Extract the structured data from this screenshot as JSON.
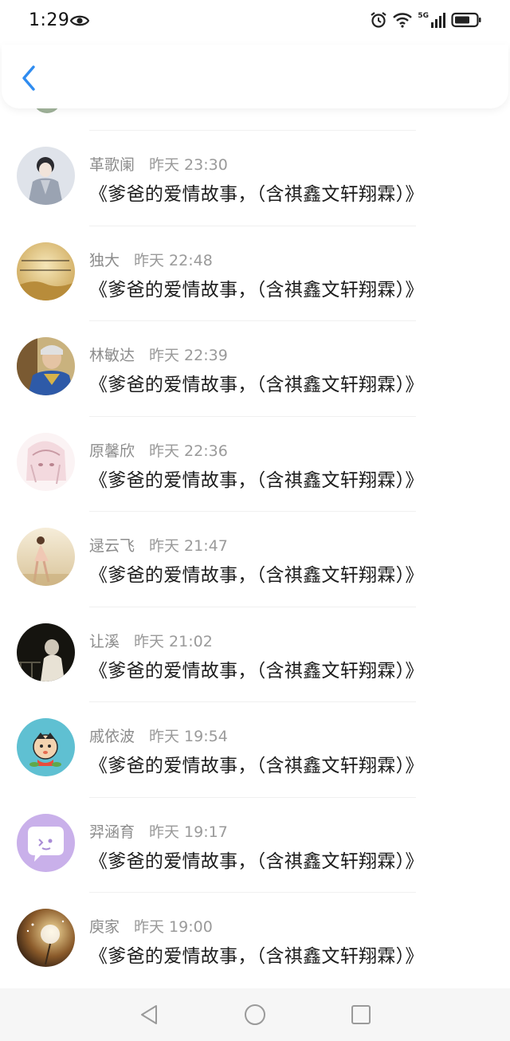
{
  "status_bar": {
    "time": "1:29",
    "network": "5G"
  },
  "header": {
    "back_icon": "chevron-left-icon",
    "accent": "#2f8cf0"
  },
  "comments": [
    {
      "name": "革歌阑",
      "time": "昨天 23:30",
      "text": "《爹爸的爱情故事，（含祺鑫文轩翔霖）》",
      "avatar": "portrait-gray"
    },
    {
      "name": "独大",
      "time": "昨天 22:48",
      "text": "《爹爸的爱情故事，（含祺鑫文轩翔霖）》",
      "avatar": "golden-field"
    },
    {
      "name": "林敏达",
      "time": "昨天 22:39",
      "text": "《爹爸的爱情故事，（含祺鑫文轩翔霖）》",
      "avatar": "man-blue-robe"
    },
    {
      "name": "原馨欣",
      "time": "昨天 22:36",
      "text": "《爹爸的爱情故事，（含祺鑫文轩翔霖）》",
      "avatar": "anime-girl"
    },
    {
      "name": "逯云飞",
      "time": "昨天 21:47",
      "text": "《爹爸的爱情故事，（含祺鑫文轩翔霖）》",
      "avatar": "dancer-beach"
    },
    {
      "name": "让溪",
      "time": "昨天 21:02",
      "text": "《爹爸的爱情故事，（含祺鑫文轩翔霖）》",
      "avatar": "dark-couple"
    },
    {
      "name": "戚依波",
      "time": "昨天 19:54",
      "text": "《爹爸的爱情故事，（含祺鑫文轩翔霖）》",
      "avatar": "cartoon-boy"
    },
    {
      "name": "羿涵育",
      "time": "昨天 19:17",
      "text": "《爹爸的爱情故事，（含祺鑫文轩翔霖）》",
      "avatar": "chat-bubble"
    },
    {
      "name": "庾家",
      "time": "昨天 19:00",
      "text": "《爹爸的爱情故事，（含祺鑫文轩翔霖）》",
      "avatar": "dandelion"
    }
  ],
  "nav_bar": {
    "back": "triangle-back-icon",
    "home": "circle-home-icon",
    "recents": "square-recents-icon"
  }
}
